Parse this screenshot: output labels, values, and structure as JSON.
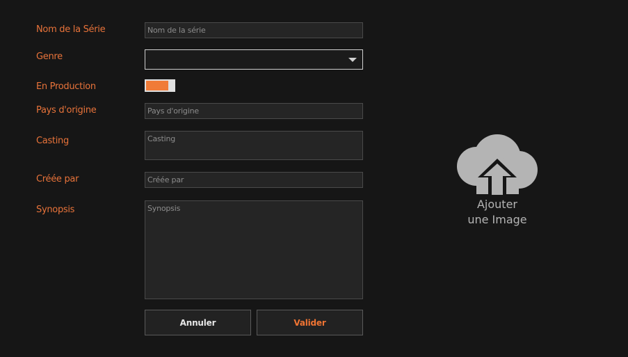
{
  "form": {
    "series_name": {
      "label": "Nom de la Série",
      "placeholder": "Nom de la série",
      "value": ""
    },
    "genre": {
      "label": "Genre",
      "value": ""
    },
    "in_production": {
      "label": "En Production",
      "checked": true,
      "accent": "#f07b37"
    },
    "country": {
      "label": "Pays d'origine",
      "placeholder": "Pays d'origine",
      "value": ""
    },
    "casting": {
      "label": "Casting",
      "placeholder": "Casting",
      "value": ""
    },
    "created_by": {
      "label": "Créée par",
      "placeholder": "Créée par",
      "value": ""
    },
    "synopsis": {
      "label": "Synopsis",
      "placeholder": "Synopsis",
      "value": ""
    }
  },
  "buttons": {
    "cancel_label": "Annuler",
    "validate_label": "Valider"
  },
  "upload": {
    "icon": "cloud-upload-icon",
    "line1": "Ajouter",
    "line2": "une Image"
  },
  "colors": {
    "accent": "#e8733a",
    "background": "#161616",
    "field_bg": "#252525",
    "icon": "#b4b4b4"
  }
}
